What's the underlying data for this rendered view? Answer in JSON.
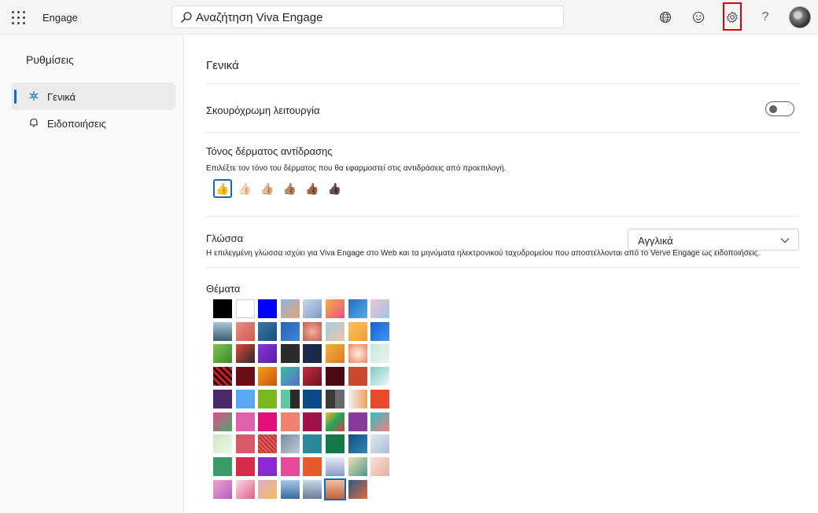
{
  "topbar": {
    "app_name": "Engage",
    "search_placeholder": "Αναζήτηση Viva Engage",
    "icons": [
      "waffle-icon",
      "globe-icon",
      "smiley-icon",
      "gear-icon",
      "help-icon",
      "avatar"
    ]
  },
  "sidebar": {
    "title": "Ρυθμίσεις",
    "items": [
      {
        "label": "Γενικά",
        "icon": "settings-snowflake-icon",
        "active": true
      },
      {
        "label": "Ειδοποιήσεις",
        "icon": "bell-icon",
        "active": false
      }
    ]
  },
  "main": {
    "title": "Γενικά",
    "dark_mode": {
      "label": "Σκουρόχρωμη λειτουργία",
      "on": false
    },
    "skin_tone": {
      "label": "Τόνος δέρματος αντίδρασης",
      "description": "Επιλέξτε τον τόνο του δέρματος που θα εφαρμοστεί στις αντιδράσεις από προεπιλογή.",
      "tones": [
        "👍",
        "👍🏻",
        "👍🏼",
        "👍🏽",
        "👍🏾",
        "👍🏿"
      ],
      "selected": 0
    },
    "language": {
      "label": "Γλώσσα",
      "selected": "Αγγλικά",
      "description": "Η επιλεγμένη γλώσσα ισχύει για Viva Engage στο Web και τα μηνύματα ηλεκτρονικού ταχυδρομείου που αποστέλλονται από το Verve Engage ως ειδοποιήσεις."
    },
    "themes": {
      "label": "Θέματα",
      "selected_index": 69,
      "swatches": [
        "#000000",
        "#ffffff",
        "#0000ff",
        "linear-gradient(135deg,#8fb4e8,#e9a46a)",
        "linear-gradient(135deg,#c9d7ea,#7f9ac7)",
        "linear-gradient(135deg,#f3b13b,#e84f8b)",
        "linear-gradient(135deg,#1f6fc4,#5aa8e8)",
        "linear-gradient(135deg,#f0c4d6,#9ec4e6)",
        "linear-gradient(180deg,#a8c6d8,#3b5f74)",
        "linear-gradient(135deg,#e8908a,#d4574a)",
        "linear-gradient(135deg,#3b78a8,#1b4d7a)",
        "linear-gradient(135deg,#2a63b8,#3a86d8)",
        "radial-gradient(circle,#f3b0a0,#c45a50)",
        "linear-gradient(135deg,#9fd0e0,#f2c0a8)",
        "linear-gradient(135deg,#f8c060,#f0a030)",
        "linear-gradient(135deg,#1a5fd0,#3b9af0)",
        "linear-gradient(135deg,#7fc255,#3e8a2a)",
        "linear-gradient(135deg,#e04a3a,#2b2b2b)",
        "linear-gradient(135deg,#8a3ad0,#5a1ab0)",
        "#2b2b2b",
        "#1b2a4a",
        "linear-gradient(135deg,#f2b040,#e07a20)",
        "radial-gradient(circle,#fff0e0,#f08060)",
        "linear-gradient(135deg,#c8e8e0,#e8f4f0)",
        "repeating-linear-gradient(45deg,#c0202a 0 3px,#2a0a0a 3px 6px)",
        "#6a0f1a",
        "linear-gradient(135deg,#f0a020,#d05010)",
        "linear-gradient(135deg,#3ac0a0,#5a6ad0)",
        "linear-gradient(135deg,#c03040,#701020)",
        "#4a0a14",
        "#c84a30",
        "linear-gradient(135deg,#80c8c0,#f0f8f8)",
        "#4a2a6a",
        "#5aa8f0",
        "#78b820",
        "linear-gradient(90deg,#60c8a0 50%,#2b2b2b 50%)",
        "#0c4a8a",
        "linear-gradient(90deg,#3a3a3a 50%,#6a6a6a 50%)",
        "linear-gradient(90deg,#f0f0f0,#f0a060)",
        "#e84a2a",
        "linear-gradient(135deg,#e04a8a,#4aa870)",
        "#e060b0",
        "#e0107a",
        "#f08070",
        "#a0104a",
        "linear-gradient(135deg,#f0c020,#20a060,#e04040)",
        "#8a3a9a",
        "linear-gradient(135deg,#30c0c0,#f08080)",
        "linear-gradient(135deg,#c8e8c0,#f0f8e8)",
        "#d85a6a",
        "repeating-linear-gradient(45deg,#e05a5a 0 2px,#c03a3a 2px 4px)",
        "linear-gradient(135deg,#7a8aa0,#c0c8d8)",
        "#2a8a9a",
        "#107a4a",
        "linear-gradient(135deg,#1a4a8a,#2a8ab0)",
        "linear-gradient(135deg,#e0e8f0,#a8c0d8)",
        "#3a9a6a",
        "#d82a4a",
        "#8a2ad0",
        "#e84a9a",
        "#e85a2a",
        "linear-gradient(180deg,#e8e8f8,#8a9ac8)",
        "linear-gradient(135deg,#f0e0b0,#4a9a8a)",
        "linear-gradient(135deg,#f8e0d8,#e8b0a0)",
        "linear-gradient(135deg,#f0a0d0,#b060c0)",
        "linear-gradient(135deg,#f8d8e8,#e06080)",
        "linear-gradient(135deg,#e0a8c8,#f0c060)",
        "linear-gradient(180deg,#a8c8e8,#3a6a9a)",
        "linear-gradient(180deg,#c8d8e8,#6a7a9a)",
        "linear-gradient(180deg,#f0c0a0,#c06040)",
        "linear-gradient(135deg,#2a5a8a,#e06a3a)"
      ]
    }
  }
}
